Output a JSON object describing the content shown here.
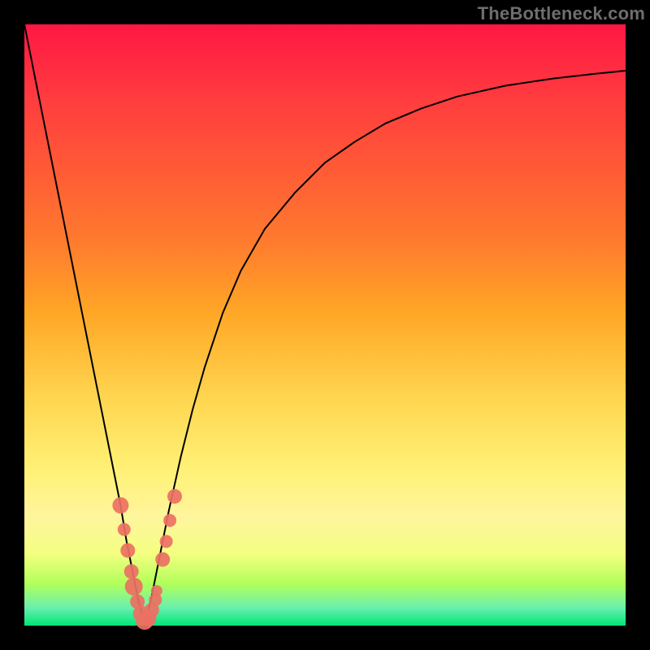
{
  "watermark": "TheBottleneck.com",
  "colors": {
    "gradient_top": "#ff1744",
    "gradient_bottom": "#00e676",
    "curve": "#000000",
    "marker": "#ec7063",
    "frame": "#000000"
  },
  "chart_data": {
    "type": "line",
    "title": "",
    "xlabel": "",
    "ylabel": "",
    "xlim": [
      0,
      100
    ],
    "ylim": [
      0,
      100
    ],
    "x_optimum": 20,
    "series": [
      {
        "name": "bottleneck-curve",
        "x": [
          0,
          2,
          4,
          6,
          8,
          10,
          12,
          14,
          16,
          17,
          18,
          19,
          20,
          21,
          22,
          23,
          24,
          26,
          28,
          30,
          33,
          36,
          40,
          45,
          50,
          55,
          60,
          66,
          72,
          80,
          88,
          95,
          100
        ],
        "y": [
          100,
          90,
          80,
          70,
          60,
          50,
          40,
          30,
          20,
          14,
          9,
          4,
          0.5,
          4,
          9,
          14,
          19,
          28,
          36,
          43,
          52,
          59,
          66,
          72,
          77,
          80.5,
          83.5,
          86,
          88,
          89.8,
          91,
          91.8,
          92.3
        ]
      }
    ],
    "markers": [
      {
        "x": 16.0,
        "y": 20.0,
        "r": 10
      },
      {
        "x": 16.6,
        "y": 16.0,
        "r": 8
      },
      {
        "x": 17.2,
        "y": 12.5,
        "r": 9
      },
      {
        "x": 17.8,
        "y": 9.0,
        "r": 9
      },
      {
        "x": 18.2,
        "y": 6.5,
        "r": 11
      },
      {
        "x": 18.8,
        "y": 4.0,
        "r": 9
      },
      {
        "x": 19.4,
        "y": 2.0,
        "r": 10
      },
      {
        "x": 20.0,
        "y": 0.8,
        "r": 11
      },
      {
        "x": 20.6,
        "y": 1.2,
        "r": 10
      },
      {
        "x": 21.2,
        "y": 2.6,
        "r": 9
      },
      {
        "x": 21.8,
        "y": 4.3,
        "r": 8
      },
      {
        "x": 22.0,
        "y": 5.8,
        "r": 7
      },
      {
        "x": 23.0,
        "y": 11.0,
        "r": 9
      },
      {
        "x": 23.6,
        "y": 14.0,
        "r": 8
      },
      {
        "x": 24.2,
        "y": 17.5,
        "r": 8
      },
      {
        "x": 25.0,
        "y": 21.5,
        "r": 9
      }
    ]
  }
}
